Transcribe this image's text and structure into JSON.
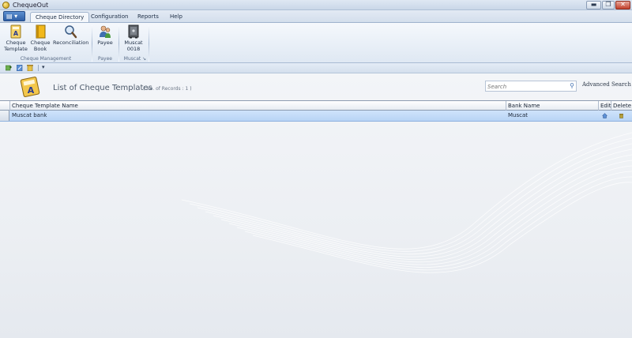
{
  "app": {
    "title": "ChequeOut"
  },
  "window": {
    "minimize": "▬",
    "maximize": "❐",
    "close": "✕"
  },
  "ribbon": {
    "app_menu_glyph": "▤ ▾",
    "tabs": [
      {
        "label": "Cheque Directory",
        "active": true
      },
      {
        "label": "Configuration",
        "active": false
      },
      {
        "label": "Reports",
        "active": false
      },
      {
        "label": "Help",
        "active": false
      }
    ],
    "buttons": {
      "cheque_template": "Cheque\nTemplate",
      "cheque_book": "Cheque\nBook",
      "reconciliation": "Reconciliation",
      "payee": "Payee",
      "muscat": "Muscat\n0018"
    },
    "groups": {
      "cheque_management": "Cheque Management",
      "payee": "Payee",
      "muscat": "Muscat"
    }
  },
  "content": {
    "title": "List of Cheque Templates",
    "records": "( No. of Records : 1 )",
    "search_placeholder": "Search",
    "advanced_search": "Advanced Search"
  },
  "grid": {
    "columns": {
      "name": "Cheque Template Name",
      "bank": "Bank Name",
      "edit": "Edit",
      "delete": "Delete"
    },
    "rows": [
      {
        "name": "Muscat bank",
        "bank": "Muscat"
      }
    ]
  },
  "colors": {
    "accent": "#2f5fa6",
    "selected_row": "#c4dcf8",
    "close_button": "#c2402c"
  },
  "icons": {
    "cheque_template": "cheque-template-icon",
    "cheque_book": "cheque-book-icon",
    "reconciliation": "magnifier-icon",
    "payee": "people-icon",
    "muscat": "safe-icon"
  }
}
